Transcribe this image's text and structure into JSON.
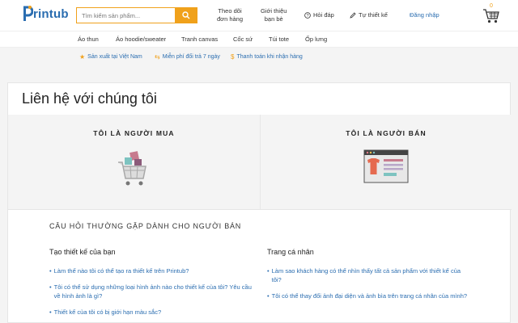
{
  "header": {
    "logo_text": "rintub",
    "search_placeholder": "Tìm kiếm sản phẩm...",
    "links": [
      {
        "line1": "Theo dõi",
        "line2": "đơn hàng"
      },
      {
        "line1": "Giới thiệu",
        "line2": "bạn bè"
      }
    ],
    "help_label": "Hỏi đáp",
    "design_label": "Tự thiết kế",
    "login_label": "Đăng nhập",
    "cart_count": "0"
  },
  "categories": [
    "Áo thun",
    "Áo hoodie/sweater",
    "Tranh canvas",
    "Cốc sứ",
    "Túi tote",
    "Ốp lưng"
  ],
  "benefits": [
    "Sản xuất tại Việt Nam",
    "Miễn phí đổi trả 7 ngày",
    "Thanh toán khi nhận hàng"
  ],
  "main": {
    "title": "Liên hệ với chúng tôi",
    "tabs": [
      {
        "label": "TÔI LÀ NGƯỜI MUA"
      },
      {
        "label": "TÔI LÀ NGƯỜI BÁN"
      }
    ],
    "faq_heading": "CÂU HỎI THƯỜNG GẶP DÀNH CHO NGƯỜI BÁN",
    "columns": [
      {
        "title": "Tạo thiết kế của bạn",
        "items": [
          "Làm thế nào tôi có thể tạo ra thiết kế trên Printub?",
          "Tôi có thể sử dụng những loại hình ảnh nào cho thiết kế của tôi? Yêu cầu về hình ảnh là gì?",
          "Thiết kế của tôi có bị giới hạn màu sắc?"
        ]
      },
      {
        "title": "Trang cá nhân",
        "items": [
          "Làm sao khách hàng có thể nhìn thấy tất cả sản phẩm với thiết kế của tôi?",
          "Tôi có thể thay đổi ảnh đại diện và ảnh bìa trên trang cá nhân của mình?"
        ]
      }
    ]
  },
  "colors": {
    "brand": "#2a6db0",
    "accent": "#f0a11b"
  }
}
